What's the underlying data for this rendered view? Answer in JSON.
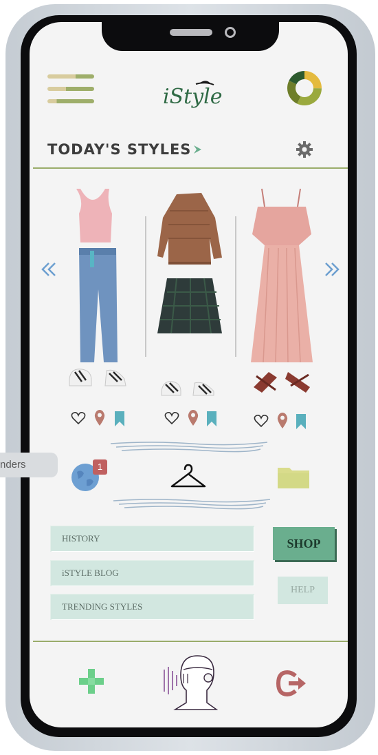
{
  "app": {
    "logo_text": "iStyle"
  },
  "header": {
    "title": "TODAY'S STYLES"
  },
  "tooltip": {
    "text": "nders"
  },
  "notifications": {
    "count": "1"
  },
  "menu": {
    "history": "HISTORY",
    "blog": "iSTYLE BLOG",
    "trending": "TRENDING STYLES",
    "shop": "SHOP",
    "help": "HELP"
  },
  "colors": {
    "accent_green": "#6aae8e",
    "divider_olive": "#9aac6a",
    "button_mint": "#d2e7e0",
    "icon_rose": "#b97a6e",
    "icon_teal": "#5ab0bd"
  },
  "outfits": [
    {
      "top": "pink crop tank top",
      "bottom": "light wash jeans",
      "shoes": "white sneakers"
    },
    {
      "top": "brown knit sweater",
      "bottom": "dark plaid skirt",
      "shoes": "white sneakers"
    },
    {
      "top": "pink ruffled maxi dress",
      "bottom": "",
      "shoes": "brown strappy sandals"
    }
  ]
}
